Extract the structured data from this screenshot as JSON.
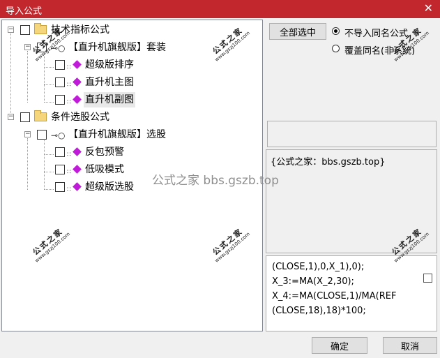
{
  "window": {
    "title": "导入公式",
    "close_glyph": "✕"
  },
  "tree": {
    "groups": [
      {
        "label": "技术指标公式",
        "expander": "−",
        "child": {
          "label": "【直升机旗舰版】套装",
          "expander": "−",
          "items": [
            "超级版排序",
            "直升机主图",
            "直升机副图"
          ]
        }
      },
      {
        "label": "条件选股公式",
        "expander": "−",
        "child": {
          "label": "【直升机旗舰版】选股",
          "expander": "−",
          "items": [
            "反包预警",
            "低吸模式",
            "超级版选股"
          ]
        }
      }
    ]
  },
  "buttons": {
    "select_all": "全部选中",
    "ok": "确定",
    "cancel": "取消"
  },
  "options": {
    "no_import_same": "不导入同名公式",
    "overwrite_same": "覆盖同名(非系统)",
    "selected": "no_import_same"
  },
  "note": {
    "text": "{公式之家：bbs.gszb.top}"
  },
  "code": {
    "lines": [
      "(CLOSE,1),0,X_1),0);",
      "X_3:=MA(X_2,30);",
      "X_4:=MA(CLOSE,1)/MA(REF",
      "(CLOSE,18),18)*100;"
    ]
  },
  "watermarks": {
    "center": "公式之家 bbs.gszb.top",
    "stamp_name": "公式之家",
    "stamp_url": "www.gszj100.com"
  }
}
